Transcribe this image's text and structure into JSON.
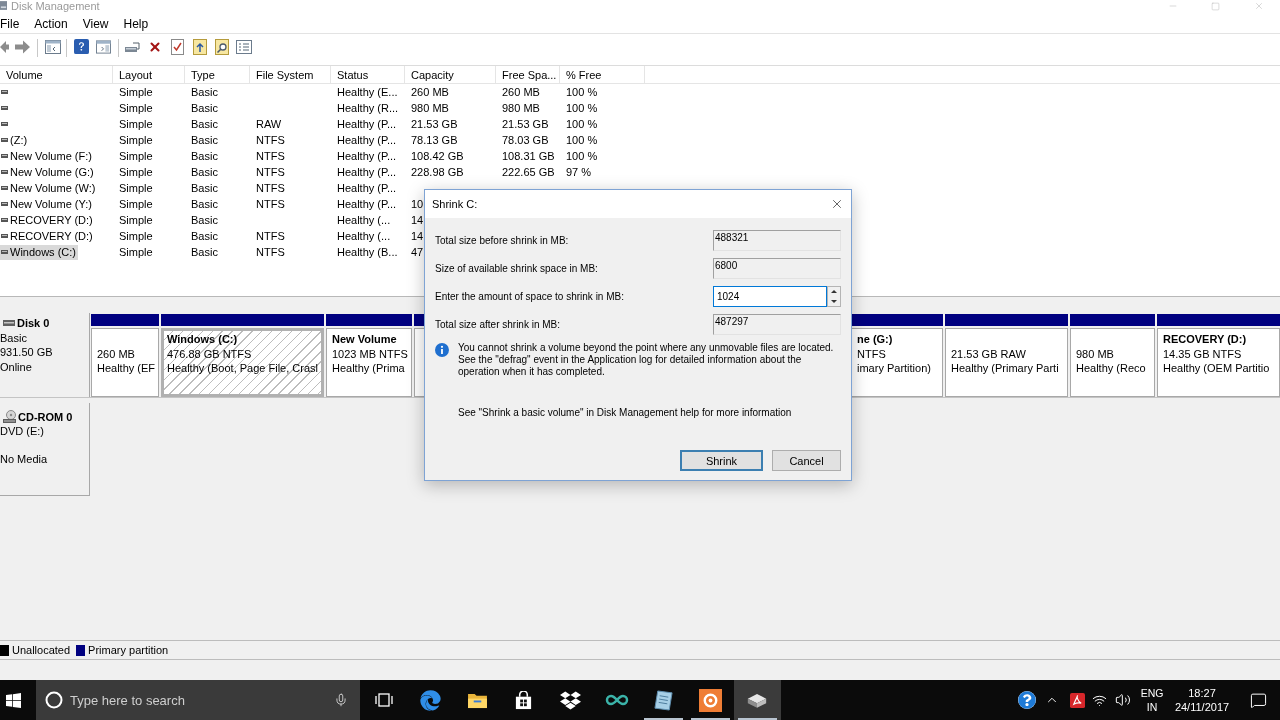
{
  "window": {
    "title": "Disk Management",
    "menu": [
      "File",
      "Action",
      "View",
      "Help"
    ]
  },
  "volume_table": {
    "columns": [
      "Volume",
      "Layout",
      "Type",
      "File System",
      "Status",
      "Capacity",
      "Free Spa...",
      "% Free"
    ],
    "rows": [
      {
        "layout": "Simple",
        "type": "Basic",
        "status": "Healthy (E...",
        "capacity": "260 MB",
        "free_space": "260 MB",
        "percent_free": "100 %",
        "selected": false
      },
      {
        "layout": "Simple",
        "type": "Basic",
        "status": "Healthy (R...",
        "capacity": "980 MB",
        "free_space": "980 MB",
        "percent_free": "100 %",
        "selected": false
      },
      {
        "layout": "Simple",
        "type": "Basic",
        "file_system": "RAW",
        "status": "Healthy (P...",
        "capacity": "21.53 GB",
        "free_space": "21.53 GB",
        "percent_free": "100 %",
        "selected": false
      },
      {
        "volume": "(Z:)",
        "layout": "Simple",
        "type": "Basic",
        "file_system": "NTFS",
        "status": "Healthy (P...",
        "capacity": "78.13 GB",
        "free_space": "78.03 GB",
        "percent_free": "100 %",
        "selected": false
      },
      {
        "volume": "New Volume (F:)",
        "layout": "Simple",
        "type": "Basic",
        "file_system": "NTFS",
        "status": "Healthy (P...",
        "capacity": "108.42 GB",
        "free_space": "108.31 GB",
        "percent_free": "100 %",
        "selected": false
      },
      {
        "volume": "New Volume (G:)",
        "layout": "Simple",
        "type": "Basic",
        "file_system": "NTFS",
        "status": "Healthy (P...",
        "capacity": "228.98 GB",
        "free_space": "222.65 GB",
        "percent_free": "97 %",
        "selected": false
      },
      {
        "volume": "New Volume (W:)",
        "layout": "Simple",
        "type": "Basic",
        "file_system": "NTFS",
        "status": "Healthy (P...",
        "selected": false
      },
      {
        "volume": "New Volume (Y:)",
        "layout": "Simple",
        "type": "Basic",
        "file_system": "NTFS",
        "status": "Healthy (P...",
        "capacity": "10",
        "selected": false
      },
      {
        "volume": "RECOVERY (D:)",
        "layout": "Simple",
        "type": "Basic",
        "status": "Healthy (...",
        "capacity": "14",
        "selected": false
      },
      {
        "volume": "RECOVERY (D:)",
        "layout": "Simple",
        "type": "Basic",
        "file_system": "NTFS",
        "status": "Healthy (...",
        "capacity": "14",
        "selected": false
      },
      {
        "volume": "Windows (C:)",
        "layout": "Simple",
        "type": "Basic",
        "file_system": "NTFS",
        "status": "Healthy (B...",
        "capacity": "47",
        "selected": true
      }
    ]
  },
  "disks": [
    {
      "kind": "disk",
      "name": "Disk 0",
      "type": "Basic",
      "size": "931.50 GB",
      "state": "Online",
      "partitions": [
        {
          "size": "260 MB",
          "status": "Healthy (EF",
          "selected": false
        },
        {
          "title": "Windows (C:)",
          "size": "476.88 GB NTFS",
          "status": "Healthy (Boot, Page File, Crasl",
          "selected": true
        },
        {
          "title": "New Volume",
          "size": "1023 MB NTFS",
          "status": "Healthy (Prima",
          "selected": false
        },
        {
          "selected": false
        },
        {
          "title": "ne (G:)",
          "size": "NTFS",
          "status": "imary Partition)",
          "selected": false
        },
        {
          "size": "21.53 GB RAW",
          "status": "Healthy (Primary Parti",
          "selected": false
        },
        {
          "size": "980 MB",
          "status": "Healthy (Reco",
          "selected": false
        },
        {
          "title": "RECOVERY (D:)",
          "size": "14.35 GB NTFS",
          "status": "Healthy (OEM Partitio",
          "selected": false
        }
      ]
    },
    {
      "kind": "cdrom",
      "name": "CD-ROM 0",
      "type": "DVD (E:)",
      "state": "No Media"
    }
  ],
  "legend": [
    {
      "label": "Unallocated",
      "color": "#000000"
    },
    {
      "label": "Primary partition",
      "color": "#000080"
    }
  ],
  "dialog": {
    "title": "Shrink C:",
    "fields": [
      {
        "label": "Total size before shrink in MB:",
        "value": "488321",
        "kind": "readonly"
      },
      {
        "label": "Size of available shrink space in MB:",
        "value": "6800",
        "kind": "readonly"
      },
      {
        "label": "Enter the amount of space to shrink in MB:",
        "value": "1024",
        "kind": "spin"
      },
      {
        "label": "Total size after shrink in MB:",
        "value": "487297",
        "kind": "readonly"
      }
    ],
    "info": "You cannot shrink a volume beyond the point where any unmovable files are located. See the \"defrag\" event in the Application log for detailed information about the operation when it has completed.",
    "help": "See \"Shrink a basic volume\" in Disk Management help for more information",
    "buttons": [
      {
        "label": "Shrink",
        "default": true
      },
      {
        "label": "Cancel",
        "default": false
      }
    ]
  },
  "taskbar": {
    "search": {
      "placeholder": "Type here to search"
    },
    "apps": [
      {
        "kind": "edge",
        "running": false,
        "selected": false
      },
      {
        "kind": "explorer",
        "running": false,
        "selected": false
      },
      {
        "kind": "store",
        "running": false,
        "selected": false
      },
      {
        "kind": "dropbox",
        "running": false,
        "selected": false
      },
      {
        "kind": "infinity",
        "running": false,
        "selected": false
      },
      {
        "kind": "notepad",
        "running": true,
        "selected": false
      },
      {
        "kind": "orange",
        "running": true,
        "selected": false
      },
      {
        "kind": "diskmgmt",
        "running": true,
        "selected": true
      }
    ],
    "tray": {
      "language": "ENG",
      "region": "IN",
      "time": "18:27",
      "date": "24/11/2017"
    }
  }
}
